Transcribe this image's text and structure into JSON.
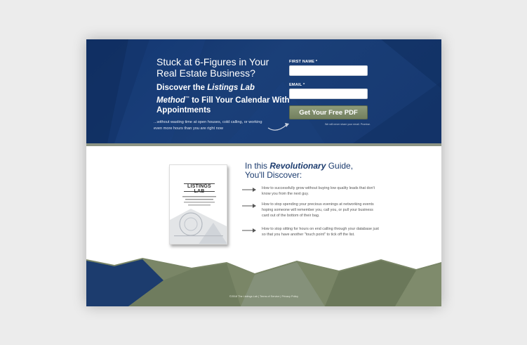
{
  "hero": {
    "headline": "Stuck at 6-Figures in Your Real Estate Business?",
    "subhead_pre": "Discover the ",
    "subhead_emph": "Listings Lab Method",
    "subhead_tm": "™",
    "subhead_post": " to Fill Your Calendar With Appointments",
    "tagline": "...without wasting time at open houses, cold calling, or working even more hours than you are right now"
  },
  "form": {
    "first_name_label": "FIRST NAME *",
    "email_label": "EMAIL *",
    "cta_label": "Get Your Free PDF",
    "privacy_note": "We will never share your email. Promise."
  },
  "guide": {
    "title_pre": "In this ",
    "title_emph": "Revolutionary",
    "title_post": " Guide,",
    "subtitle": "You'll Discover:",
    "bullets": [
      "How to successfully grow without buying low quality leads that don't know you from the next guy.",
      "How to stop spending your precious evenings at networking events hoping someone will remember you, call you, or pull your business card out of the bottom of their bag.",
      "How to stop sitting for hours on end calling through your database just so that you have another \"touch point\" to tick off the list."
    ]
  },
  "book": {
    "title": "LISTINGS LAB"
  },
  "footer": {
    "copyright": "©2018 The Listings Lab",
    "sep": "|",
    "terms": "Terms of Service",
    "privacy": "Privacy Policy"
  },
  "colors": {
    "navy": "#12336a",
    "olive": "#7a8667",
    "cta": "#7f8c6b"
  }
}
